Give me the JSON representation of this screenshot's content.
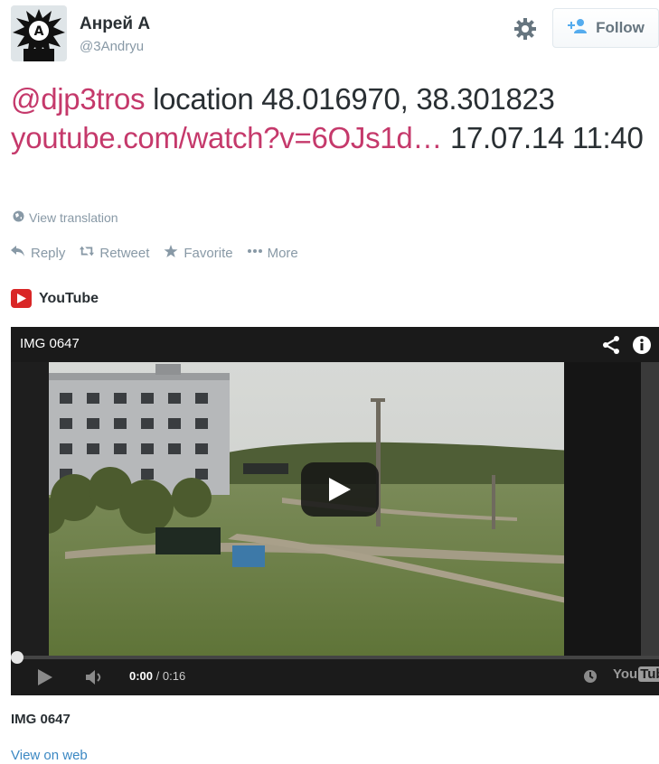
{
  "user": {
    "display_name": "Анрей А",
    "handle": "@3Andryu"
  },
  "header": {
    "follow_label": "Follow",
    "gear_icon": "gear-icon",
    "follow_icon": "add-user-icon"
  },
  "tweet": {
    "mention": "@djp3tros",
    "text_part1": " location 48.016970, 38.301823",
    "link": "youtube.com/watch?v=6OJs1d…",
    "text_part2": " 17.07.14 11:40",
    "link_color": "#c5396b"
  },
  "translation": {
    "label": "View translation",
    "icon": "globe-icon"
  },
  "actions": {
    "reply": "Reply",
    "retweet": "Retweet",
    "favorite": "Favorite",
    "more": "More"
  },
  "card": {
    "source": "YouTube",
    "source_icon": "youtube-logo-icon",
    "video_title": "IMG 0647",
    "time_current": "0:00",
    "time_separator": " / ",
    "time_total": "0:16",
    "progress": 0,
    "watermark_you": "You",
    "watermark_tube": "Tube",
    "title": "IMG 0647",
    "view_on_web": "View on web"
  },
  "colors": {
    "accent_link": "#3b88c3",
    "mention": "#c5396b",
    "youtube_red": "#d92727"
  }
}
